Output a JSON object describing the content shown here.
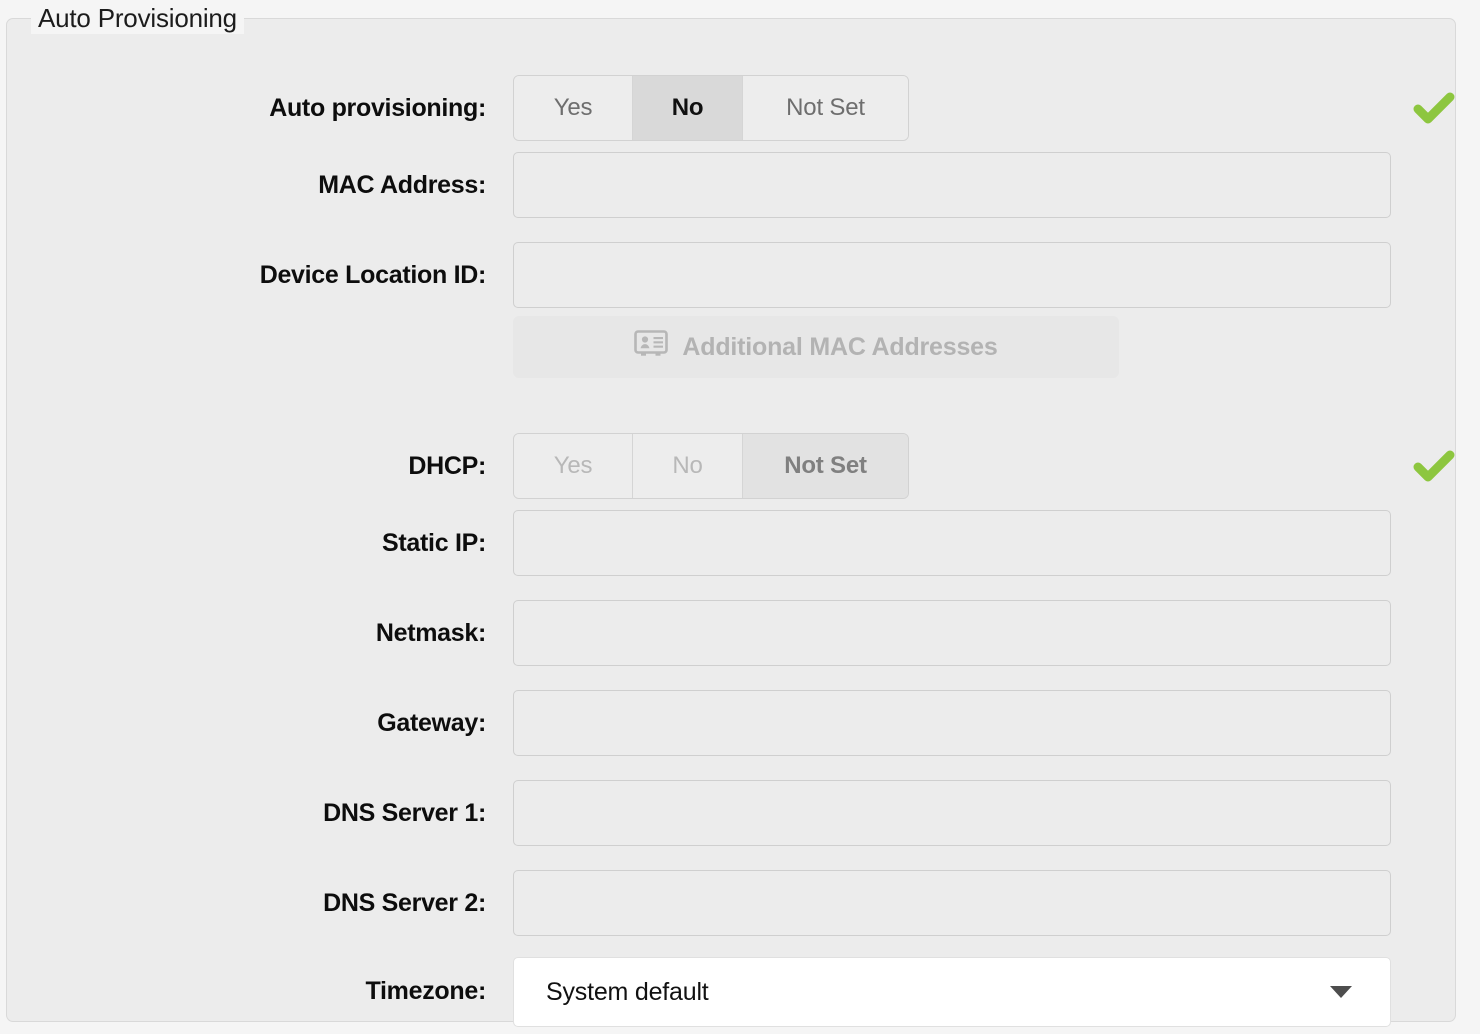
{
  "group": {
    "legend": "Auto Provisioning"
  },
  "rows": {
    "auto_provisioning": {
      "label": "Auto provisioning:",
      "options": [
        "Yes",
        "No",
        "Not Set"
      ],
      "selected": "No",
      "valid": true
    },
    "mac_address": {
      "label": "MAC Address:",
      "value": "",
      "placeholder": ""
    },
    "device_location_id": {
      "label": "Device Location ID:",
      "value": "",
      "placeholder": ""
    },
    "additional_mac": {
      "button_label": "Additional MAC Addresses",
      "icon": "vcard-icon",
      "disabled": true
    },
    "dhcp": {
      "label": "DHCP:",
      "options": [
        "Yes",
        "No",
        "Not Set"
      ],
      "selected": "Not Set",
      "valid": true
    },
    "static_ip": {
      "label": "Static IP:",
      "value": "",
      "placeholder": ""
    },
    "netmask": {
      "label": "Netmask:",
      "value": "",
      "placeholder": ""
    },
    "gateway": {
      "label": "Gateway:",
      "value": "",
      "placeholder": ""
    },
    "dns_server_1": {
      "label": "DNS Server 1:",
      "value": "",
      "placeholder": ""
    },
    "dns_server_2": {
      "label": "DNS Server 2:",
      "value": "",
      "placeholder": ""
    },
    "timezone": {
      "label": "Timezone:",
      "selected": "System default",
      "options": [
        "System default"
      ]
    }
  },
  "colors": {
    "valid_check": "#8DC63F",
    "page_background": "#f5f5f5",
    "panel_background": "#ececec",
    "selected_segment": "#d9d9d9"
  }
}
